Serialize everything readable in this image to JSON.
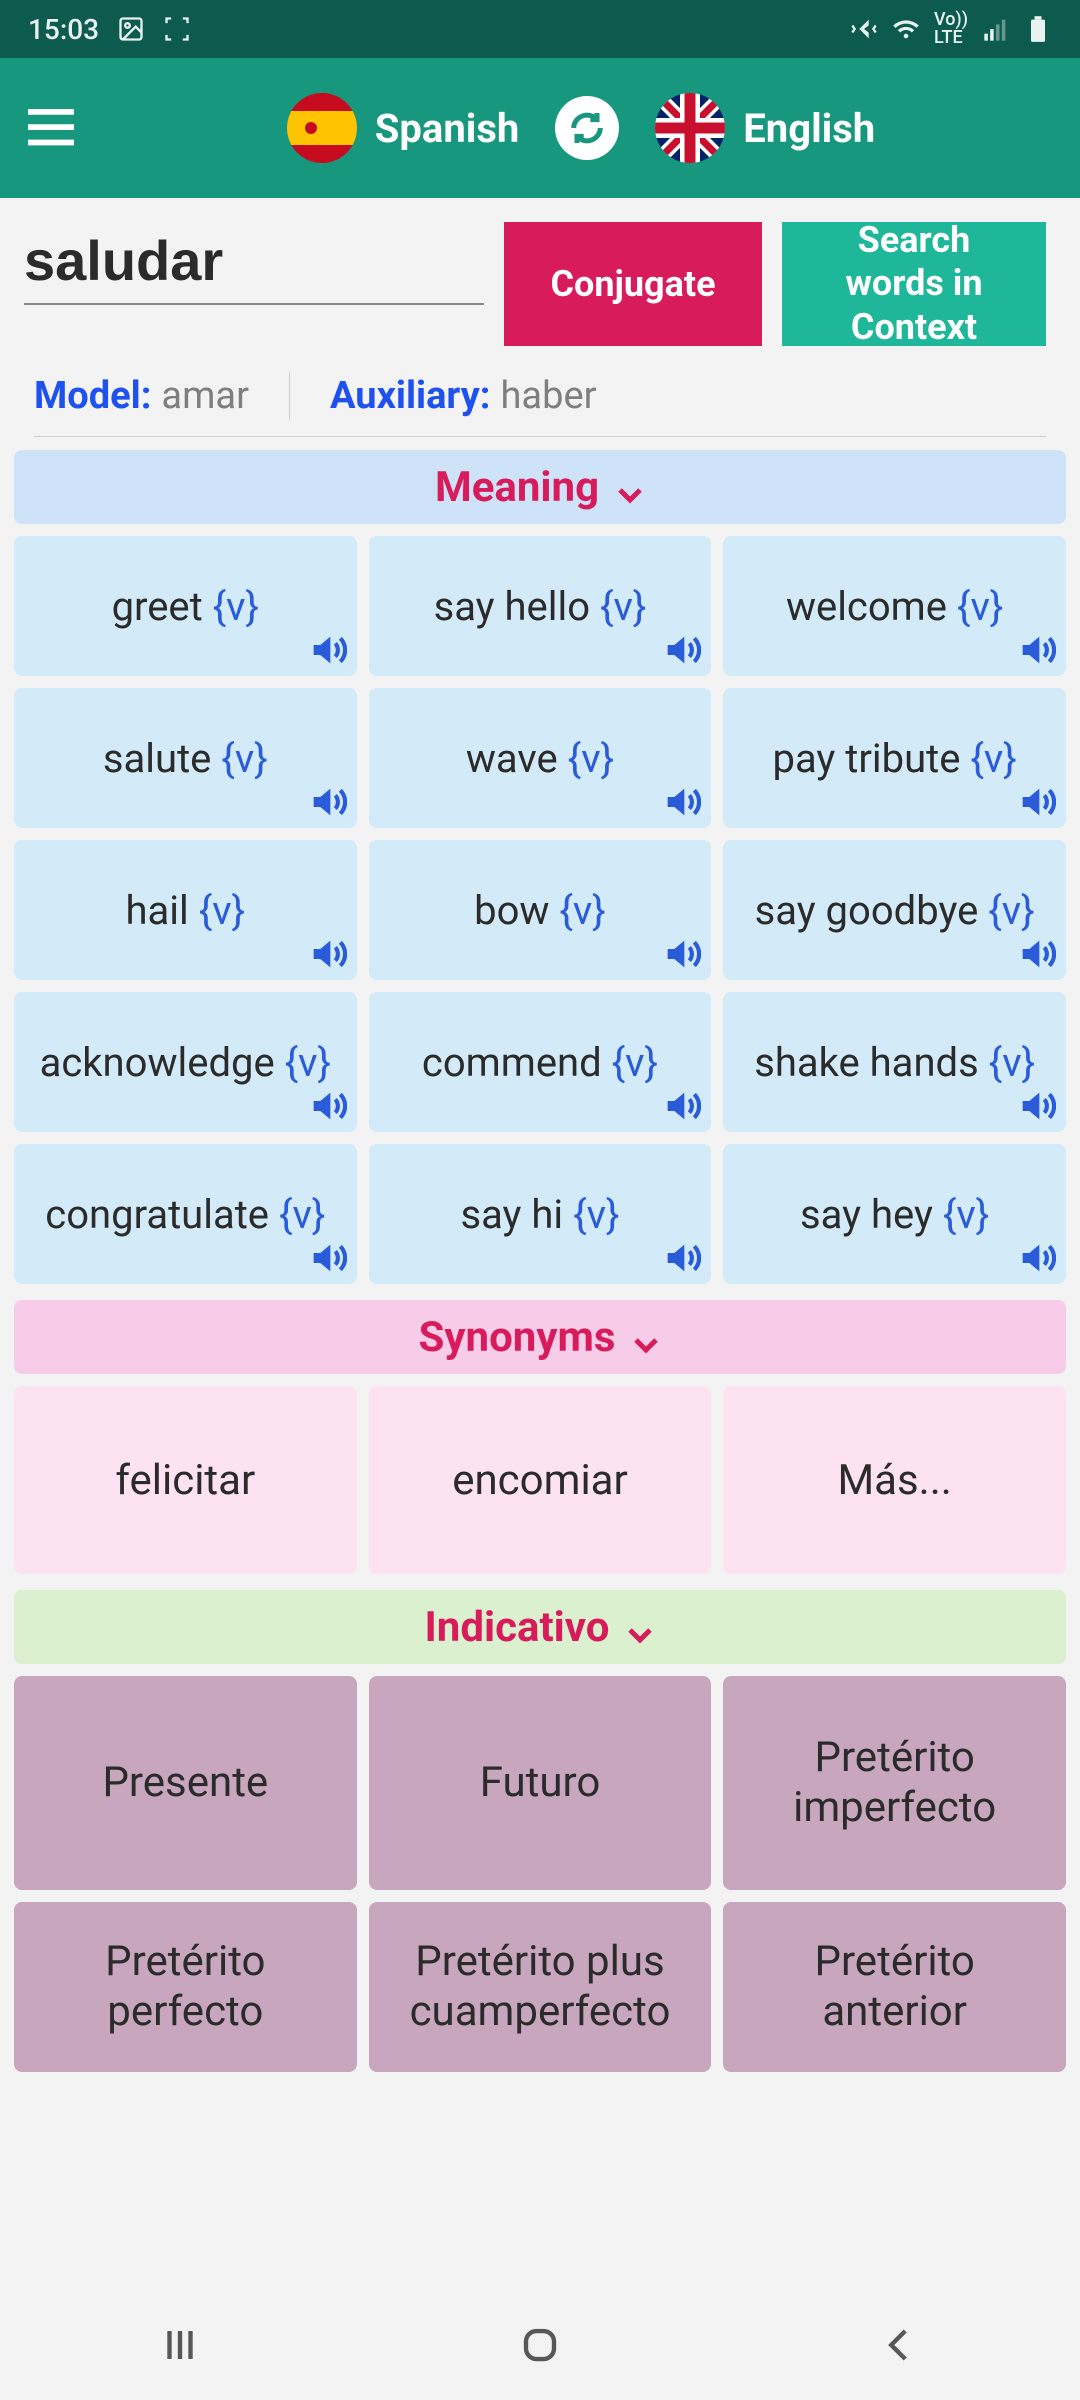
{
  "status": {
    "time": "15:03"
  },
  "header": {
    "source_lang": "Spanish",
    "target_lang": "English"
  },
  "search": {
    "value": "saludar",
    "conjugate_label": "Conjugate",
    "context_label": "Search words in Context"
  },
  "meta": {
    "model_label": "Model:",
    "model_value": "amar",
    "aux_label": "Auxiliary:",
    "aux_value": "haber"
  },
  "sections": {
    "meaning": "Meaning",
    "synonyms": "Synonyms",
    "indicative": "Indicativo"
  },
  "pos_tag": "{v}",
  "meanings": [
    "greet",
    "say hello",
    "welcome",
    "salute",
    "wave",
    "pay tribute",
    "hail",
    "bow",
    "say goodbye",
    "acknowledge",
    "commend",
    "shake hands",
    "congratulate",
    "say hi",
    "say hey"
  ],
  "synonyms": [
    "felicitar",
    "encomiar",
    "Más..."
  ],
  "tenses": [
    "Presente",
    "Futuro",
    "Pretérito imperfecto",
    "Pretérito perfecto",
    "Pretérito plus cuamperfecto",
    "Pretérito anterior"
  ]
}
